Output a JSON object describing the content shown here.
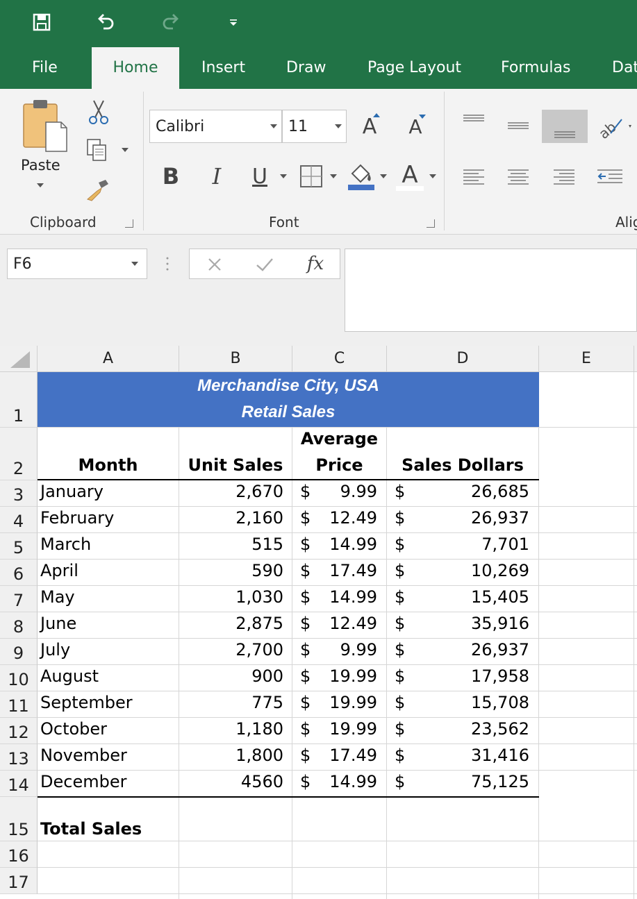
{
  "tabs": [
    "File",
    "Home",
    "Insert",
    "Draw",
    "Page Layout",
    "Formulas",
    "Dat"
  ],
  "active_tab": "Home",
  "ribbon": {
    "paste_label": "Paste",
    "clipboard_label": "Clipboard",
    "font_label": "Font",
    "alignment_label": "Alig",
    "font_name": "Calibri",
    "font_size": "11",
    "bold": "B",
    "italic": "I",
    "underline": "U",
    "font_color_glyph": "A",
    "grow_font": "A",
    "shrink_font": "A"
  },
  "formula_bar": {
    "name_box": "F6",
    "fx": "fx",
    "formula": ""
  },
  "columns": [
    "A",
    "B",
    "C",
    "D",
    "E"
  ],
  "rows": [
    "1",
    "2",
    "3",
    "4",
    "5",
    "6",
    "7",
    "8",
    "9",
    "10",
    "11",
    "12",
    "13",
    "14",
    "15",
    "16",
    "17"
  ],
  "title_line1": "Merchandise City, USA",
  "title_line2": "Retail Sales",
  "headers": {
    "month": "Month",
    "unit_sales": "Unit Sales",
    "avg_price_1": "Average",
    "avg_price_2": "Price",
    "sales_dollars": "Sales Dollars"
  },
  "data": [
    {
      "month": "January",
      "units": "2,670",
      "price": "9.99",
      "sales": "26,685"
    },
    {
      "month": "February",
      "units": "2,160",
      "price": "12.49",
      "sales": "26,937"
    },
    {
      "month": "March",
      "units": "515",
      "price": "14.99",
      "sales": "7,701"
    },
    {
      "month": "April",
      "units": "590",
      "price": "17.49",
      "sales": "10,269"
    },
    {
      "month": "May",
      "units": "1,030",
      "price": "14.99",
      "sales": "15,405"
    },
    {
      "month": "June",
      "units": "2,875",
      "price": "12.49",
      "sales": "35,916"
    },
    {
      "month": "July",
      "units": "2,700",
      "price": "9.99",
      "sales": "26,937"
    },
    {
      "month": "August",
      "units": "900",
      "price": "19.99",
      "sales": "17,958"
    },
    {
      "month": "September",
      "units": "775",
      "price": "19.99",
      "sales": "15,708"
    },
    {
      "month": "October",
      "units": "1,180",
      "price": "19.99",
      "sales": "23,562"
    },
    {
      "month": "November",
      "units": "1,800",
      "price": "17.49",
      "sales": "31,416"
    },
    {
      "month": "December",
      "units": "4560",
      "price": "14.99",
      "sales": "75,125"
    }
  ],
  "currency": "$",
  "total_label": "Total Sales",
  "colors": {
    "excel_green": "#217346",
    "title_fill": "#4472c4",
    "ribbon_bg": "#f3f3f3"
  }
}
